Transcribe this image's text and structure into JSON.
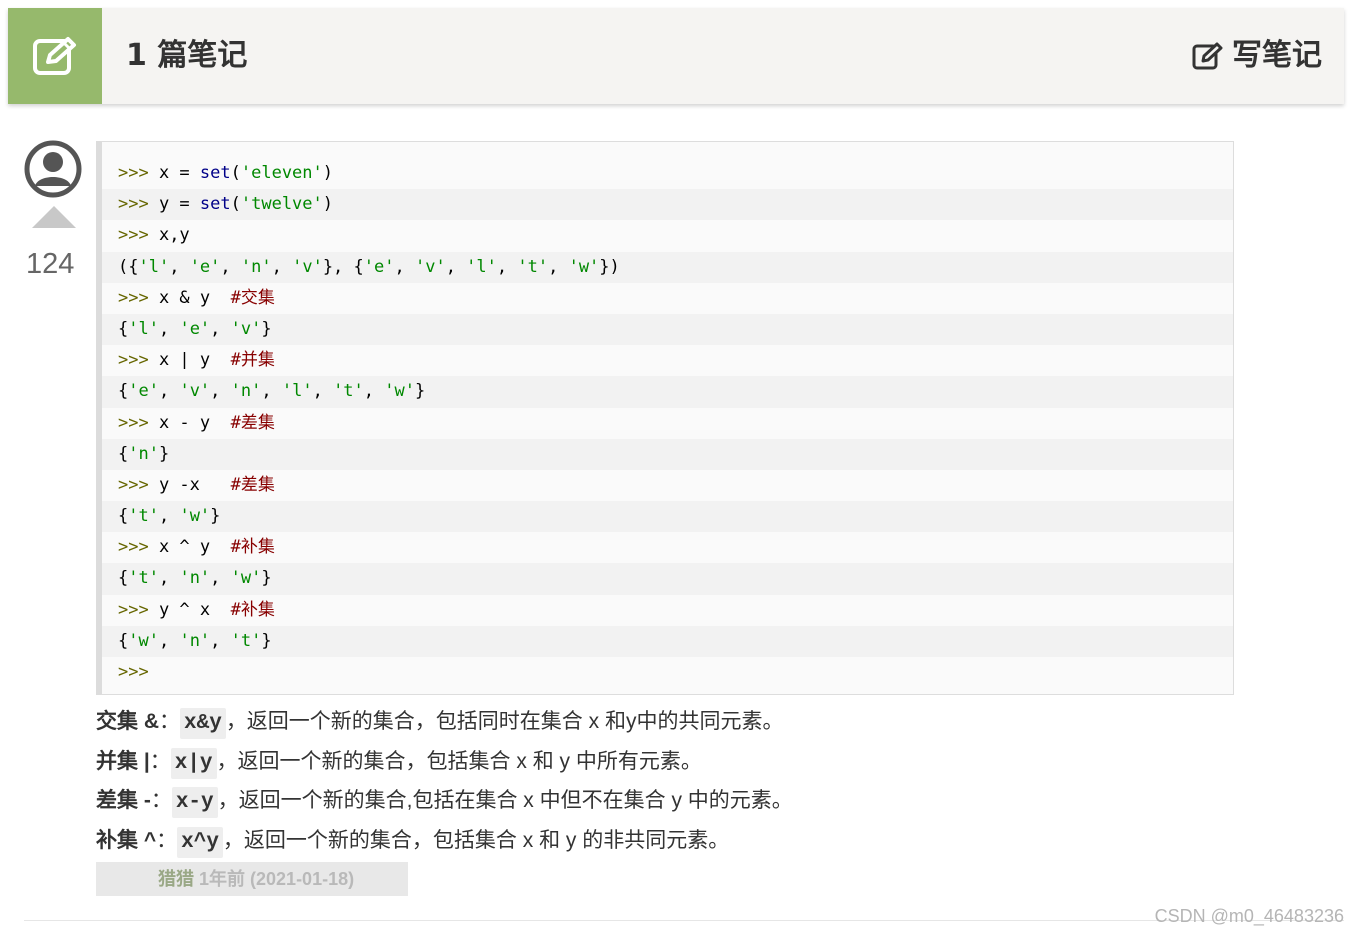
{
  "header": {
    "title": "1 篇笔记",
    "write_label": "写笔记",
    "accent_color": "#96b96c"
  },
  "note": {
    "vote_count": "124",
    "code_lines": [
      [
        {
          "t": ">>> ",
          "c": "p"
        },
        {
          "t": "x = "
        },
        {
          "t": "set",
          "c": "k"
        },
        {
          "t": "("
        },
        {
          "t": "'eleven'",
          "c": "s"
        },
        {
          "t": ")"
        }
      ],
      [
        {
          "t": ">>> ",
          "c": "p"
        },
        {
          "t": "y = "
        },
        {
          "t": "set",
          "c": "k"
        },
        {
          "t": "("
        },
        {
          "t": "'twelve'",
          "c": "s"
        },
        {
          "t": ")"
        }
      ],
      [
        {
          "t": ">>> ",
          "c": "p"
        },
        {
          "t": "x,y"
        }
      ],
      [
        {
          "t": "({"
        },
        {
          "t": "'l'",
          "c": "s"
        },
        {
          "t": ", "
        },
        {
          "t": "'e'",
          "c": "s"
        },
        {
          "t": ", "
        },
        {
          "t": "'n'",
          "c": "s"
        },
        {
          "t": ", "
        },
        {
          "t": "'v'",
          "c": "s"
        },
        {
          "t": "}, {"
        },
        {
          "t": "'e'",
          "c": "s"
        },
        {
          "t": ", "
        },
        {
          "t": "'v'",
          "c": "s"
        },
        {
          "t": ", "
        },
        {
          "t": "'l'",
          "c": "s"
        },
        {
          "t": ", "
        },
        {
          "t": "'t'",
          "c": "s"
        },
        {
          "t": ", "
        },
        {
          "t": "'w'",
          "c": "s"
        },
        {
          "t": "})"
        }
      ],
      [
        {
          "t": ">>> ",
          "c": "p"
        },
        {
          "t": "x & y  "
        },
        {
          "t": "#交集",
          "c": "c"
        }
      ],
      [
        {
          "t": "{"
        },
        {
          "t": "'l'",
          "c": "s"
        },
        {
          "t": ", "
        },
        {
          "t": "'e'",
          "c": "s"
        },
        {
          "t": ", "
        },
        {
          "t": "'v'",
          "c": "s"
        },
        {
          "t": "}"
        }
      ],
      [
        {
          "t": ">>> ",
          "c": "p"
        },
        {
          "t": "x | y  "
        },
        {
          "t": "#并集",
          "c": "c"
        }
      ],
      [
        {
          "t": "{"
        },
        {
          "t": "'e'",
          "c": "s"
        },
        {
          "t": ", "
        },
        {
          "t": "'v'",
          "c": "s"
        },
        {
          "t": ", "
        },
        {
          "t": "'n'",
          "c": "s"
        },
        {
          "t": ", "
        },
        {
          "t": "'l'",
          "c": "s"
        },
        {
          "t": ", "
        },
        {
          "t": "'t'",
          "c": "s"
        },
        {
          "t": ", "
        },
        {
          "t": "'w'",
          "c": "s"
        },
        {
          "t": "}"
        }
      ],
      [
        {
          "t": ">>> ",
          "c": "p"
        },
        {
          "t": "x - y  "
        },
        {
          "t": "#差集",
          "c": "c"
        }
      ],
      [
        {
          "t": "{"
        },
        {
          "t": "'n'",
          "c": "s"
        },
        {
          "t": "}"
        }
      ],
      [
        {
          "t": ">>> ",
          "c": "p"
        },
        {
          "t": "y -x   "
        },
        {
          "t": "#差集",
          "c": "c"
        }
      ],
      [
        {
          "t": "{"
        },
        {
          "t": "'t'",
          "c": "s"
        },
        {
          "t": ", "
        },
        {
          "t": "'w'",
          "c": "s"
        },
        {
          "t": "}"
        }
      ],
      [
        {
          "t": ">>> ",
          "c": "p"
        },
        {
          "t": "x ^ y  "
        },
        {
          "t": "#补集",
          "c": "c"
        }
      ],
      [
        {
          "t": "{"
        },
        {
          "t": "'t'",
          "c": "s"
        },
        {
          "t": ", "
        },
        {
          "t": "'n'",
          "c": "s"
        },
        {
          "t": ", "
        },
        {
          "t": "'w'",
          "c": "s"
        },
        {
          "t": "}"
        }
      ],
      [
        {
          "t": ">>> ",
          "c": "p"
        },
        {
          "t": "y ^ x  "
        },
        {
          "t": "#补集",
          "c": "c"
        }
      ],
      [
        {
          "t": "{"
        },
        {
          "t": "'w'",
          "c": "s"
        },
        {
          "t": ", "
        },
        {
          "t": "'n'",
          "c": "s"
        },
        {
          "t": ", "
        },
        {
          "t": "'t'",
          "c": "s"
        },
        {
          "t": "}"
        }
      ],
      [
        {
          "t": ">>>",
          "c": "p"
        }
      ]
    ],
    "descriptions": [
      {
        "term": "交集 &",
        "sep": "：",
        "code": "x&y",
        "text": "，返回一个新的集合，包括同时在集合 x 和y中的共同元素。"
      },
      {
        "term": "并集 |",
        "sep": "：",
        "code": "x|y",
        "text": "，返回一个新的集合，包括集合 x 和 y 中所有元素。"
      },
      {
        "term": "差集 -",
        "sep": "：",
        "code": "x-y",
        "text": "，返回一个新的集合,包括在集合 x 中但不在集合 y 中的元素。"
      },
      {
        "term": "补集 ^",
        "sep": "：",
        "code": "x^y",
        "text": "，返回一个新的集合，包括集合 x 和 y 的非共同元素。"
      }
    ],
    "author": "猎猎",
    "time": "1年前 (2021-01-18)"
  },
  "watermark": "CSDN @m0_46483236"
}
